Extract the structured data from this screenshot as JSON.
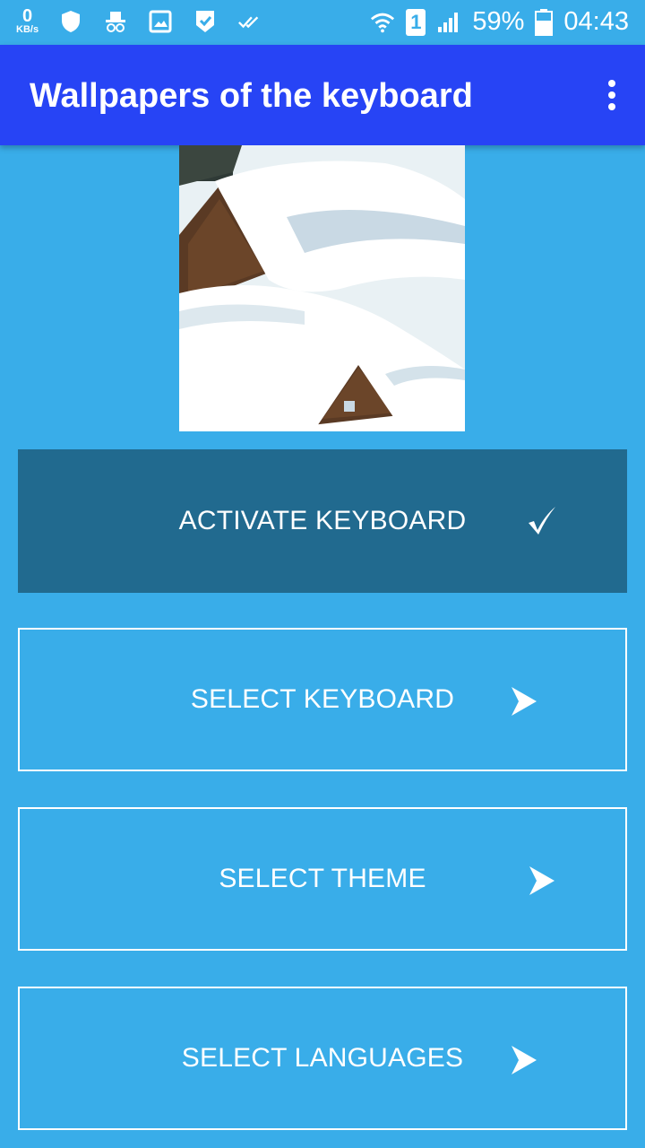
{
  "status_bar": {
    "speed_value": "0",
    "speed_unit": "KB/s",
    "sim_slot": "1",
    "battery": "59%",
    "time": "04:43",
    "icons": [
      "shield-icon",
      "incognito-icon",
      "image-icon",
      "check-shield-icon",
      "double-check-icon",
      "wifi-icon",
      "sim-icon",
      "signal-icon",
      "battery-icon"
    ]
  },
  "appbar": {
    "title": "Wallpapers of the keyboard",
    "menu_icon": "more-vert-icon",
    "color": "#2744F5"
  },
  "preview": {
    "icon": "snow-cabin-wallpaper"
  },
  "buttons": [
    {
      "label": "ACTIVATE KEYBOARD",
      "icon": "checkmark-icon",
      "style": "filled"
    },
    {
      "label": "SELECT KEYBOARD",
      "icon": "arrow-right-icon",
      "style": "outline"
    },
    {
      "label": "SELECT THEME",
      "icon": "arrow-right-icon",
      "style": "outline"
    },
    {
      "label": "SELECT LANGUAGES",
      "icon": "arrow-right-icon",
      "style": "outline"
    }
  ],
  "colors": {
    "background": "#39ADE9",
    "filled_button": "#216A8F",
    "text": "#FFFFFF"
  }
}
